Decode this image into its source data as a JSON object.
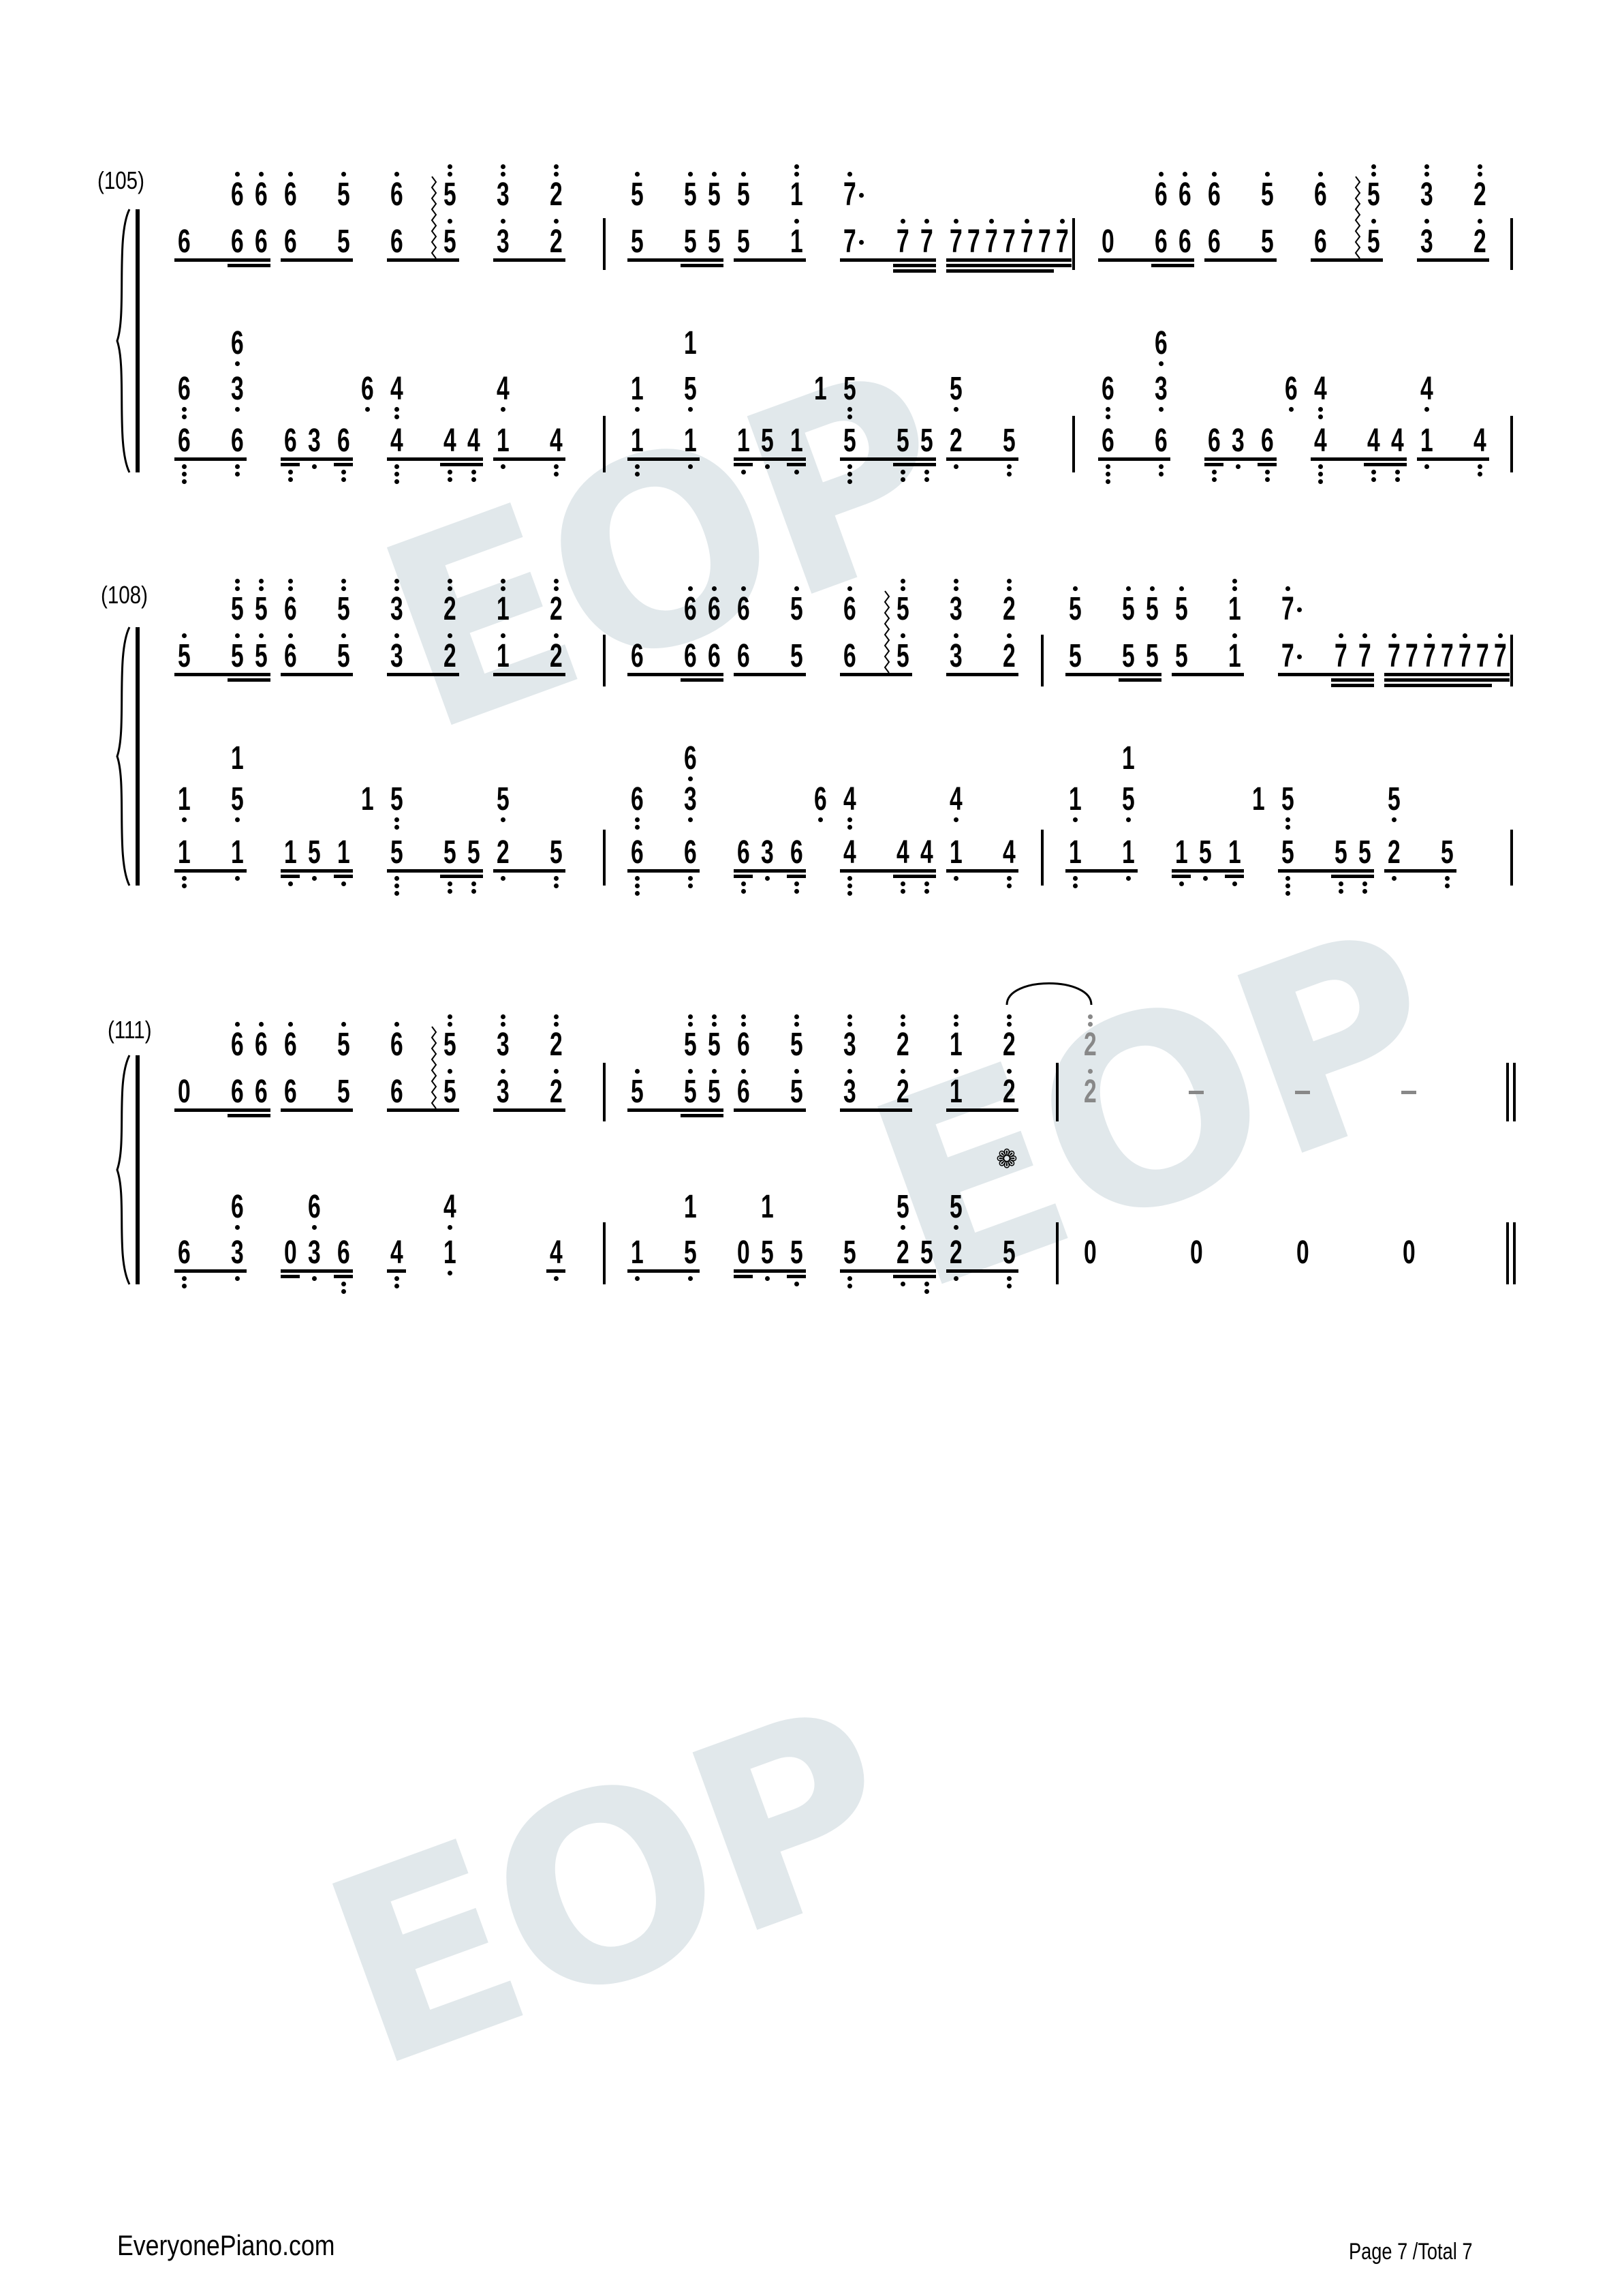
{
  "watermark": "EOP",
  "footer": {
    "site": "EveryonePiano.com",
    "page": "Page 7 /Total 7"
  },
  "pedal_symbol": "❁",
  "systems": [
    {
      "number": "(105)",
      "measures": [
        {
          "treble": {
            "upper": [
              "x 6'6'",
              "6' 5'",
              "6' 5''",
              "3'' 2''"
            ],
            "lower": [
              "6_ 6__6__",
              "6_ 5_",
              "6_ ~5'_",
              "3'_ 2'_"
            ]
          },
          "bass": {
            "top": [
              "x 6,",
              "x x",
              "x x",
              "x x"
            ],
            "mid": [
              "6,, 3,",
              "x x6,",
              "4,, x",
              "4, x"
            ],
            "low": [
              "6,,,_ 6,,_",
              "6,,__3,_ 6,,__",
              "4,,,_ 4,,__4,,__",
              "1,_ 4,,_"
            ]
          }
        },
        {
          "treble": {
            "upper": [
              "5' 5'5'",
              "5' 1''",
              "7'. x",
              "x x"
            ],
            "lower": [
              "5_ 5__5__",
              "5_ 1'_",
              "7._ 7'___7'___",
              "7'___7___7'___7___7'___7___7'__"
            ]
          },
          "bass": {
            "top": [
              "x 1",
              "x x",
              "x x",
              "x x"
            ],
            "mid": [
              "1, 5,",
              "x x1",
              "5,, x",
              "5, x"
            ],
            "low": [
              "1,,_ 1,_",
              "1,__5,_ 1,__",
              "5,,,_ 5,,__5,,__",
              "2,_ 5,,_"
            ]
          }
        },
        {
          "treble": {
            "upper": [
              "x 6'6'",
              "6' 5'",
              "6' 5''",
              "3'' 2''"
            ],
            "lower": [
              "0_ 6__6__",
              "6_ 5_",
              "6_ ~5'_",
              "3'_ 2'_"
            ]
          },
          "bass": {
            "top": [
              "x 6,",
              "x x",
              "x x",
              "x x"
            ],
            "mid": [
              "6,, 3,",
              "x x6,",
              "4,, x",
              "4, x"
            ],
            "low": [
              "6,,,_ 6,,_",
              "6,,__3,_ 6,,__",
              "4,,,_ 4,,__4,,__",
              "1,_ 4,,_"
            ]
          }
        }
      ]
    },
    {
      "number": "(108)",
      "measures": [
        {
          "treble": {
            "upper": [
              "x 5''5''",
              "6'' 5''",
              "3'' 2''",
              "1'' 2''"
            ],
            "lower": [
              "5'_ 5'__5'__",
              "6'_ 5'_",
              "3'_ 2'_",
              "1'_ 2'_"
            ]
          },
          "bass": {
            "top": [
              "x 1",
              "x x",
              "x x",
              "x x"
            ],
            "mid": [
              "1, 5,",
              "x x1",
              "5,, x",
              "5, x"
            ],
            "low": [
              "1,,_ 1,_",
              "1,__5,_ 1,__",
              "5,,,_ 5,,__5,,__",
              "2,_ 5,,_"
            ]
          }
        },
        {
          "treble": {
            "upper": [
              "x 6'6'",
              "6' 5'",
              "6' 5''",
              "3'' 2''"
            ],
            "lower": [
              "6_ 6__6__",
              "6_ 5_",
              "6_ ~5'_",
              "3'_ 2'_"
            ]
          },
          "bass": {
            "top": [
              "x 6,",
              "x x",
              "x x",
              "x x"
            ],
            "mid": [
              "6,, 3,",
              "x x6,",
              "4,, x",
              "4, x"
            ],
            "low": [
              "6,,,_ 6,,_",
              "6,,__3,_ 6,,__",
              "4,,,_ 4,,__4,,__",
              "1,_ 4,,_"
            ]
          }
        },
        {
          "treble": {
            "upper": [
              "5' 5'5'",
              "5' 1''",
              "7'. x",
              "x x"
            ],
            "lower": [
              "5_ 5__5__",
              "5_ 1'_",
              "7._ 7'___7'___",
              "7'___7___7'___7___7'___7___7'__"
            ]
          },
          "bass": {
            "top": [
              "x 1",
              "x x",
              "x x",
              "x x"
            ],
            "mid": [
              "1, 5,",
              "x x1",
              "5,, x",
              "5, x"
            ],
            "low": [
              "1,,_ 1,_",
              "1,__5,_ 1,__",
              "5,,,_ 5,,__5,,__",
              "2,_ 5,,_"
            ]
          }
        }
      ]
    },
    {
      "number": "(111)",
      "measures": [
        {
          "treble": {
            "upper": [
              "x 6'6'",
              "6' 5'",
              "6' 5''",
              "3'' 2''"
            ],
            "lower": [
              "0_ 6__6__",
              "6_ 5_",
              "6_ ~5'_",
              "3'_ 2'_"
            ]
          },
          "bass": {
            "mid": [
              "x 6,",
              "x6, x",
              "x 4,",
              "x x"
            ],
            "low": [
              "6,,_ 3,_",
              "0__3,_ 6,,__",
              "4,,_ 1,",
              "x 4,_"
            ]
          }
        },
        {
          "treble": {
            "upper": [
              "x 5''5''",
              "6'' 5''",
              "3'' 2''",
              "1'' 2''"
            ],
            "lower": [
              "5'_ 5'__5'__",
              "6'_ 5'_",
              "3'_ 2'_",
              "1'_ 2'_"
            ]
          },
          "bass": {
            "mid": [
              "x 1",
              "x1 x",
              "x 5,x",
              "5, x"
            ],
            "low": [
              "1,_ 5,_",
              "0__5,_ 5,__",
              "5,,_ 2,__5,,__",
              "2,_ 5,,_"
            ]
          }
        },
        {
          "treble": {
            "upper": [
              "g2''",
              "",
              "",
              ""
            ],
            "lower": [
              "g2'",
              "g-",
              "g-",
              "g-"
            ]
          },
          "bass": {
            "low": [
              "0",
              "0",
              "0",
              "0"
            ]
          }
        }
      ]
    }
  ]
}
